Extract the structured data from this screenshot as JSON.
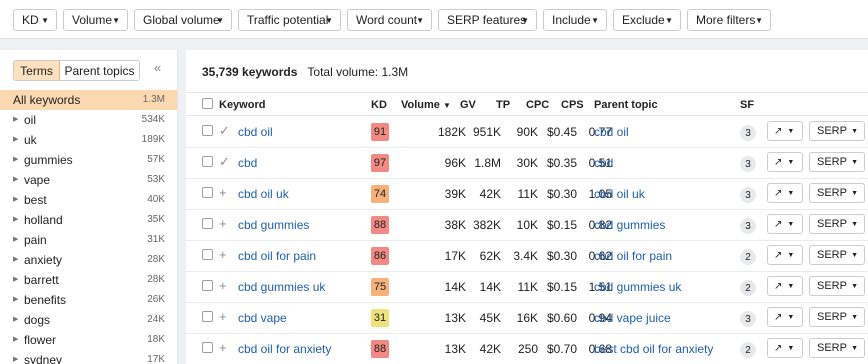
{
  "filters": [
    {
      "label": "KD"
    },
    {
      "label": "Volume"
    },
    {
      "label": "Global volume"
    },
    {
      "label": "Traffic potential"
    },
    {
      "label": "Word count"
    },
    {
      "label": "SERP features"
    },
    {
      "label": "Include"
    },
    {
      "label": "Exclude"
    },
    {
      "label": "More filters"
    }
  ],
  "sidebar": {
    "tab_terms": "Terms",
    "tab_parent": "Parent topics",
    "collapse_icon": "«",
    "all": {
      "label": "All keywords",
      "count": "1.3M"
    },
    "items": [
      {
        "label": "oil",
        "count": "534K"
      },
      {
        "label": "uk",
        "count": "189K"
      },
      {
        "label": "gummies",
        "count": "57K"
      },
      {
        "label": "vape",
        "count": "53K"
      },
      {
        "label": "best",
        "count": "40K"
      },
      {
        "label": "holland",
        "count": "35K"
      },
      {
        "label": "pain",
        "count": "31K"
      },
      {
        "label": "anxiety",
        "count": "28K"
      },
      {
        "label": "barrett",
        "count": "28K"
      },
      {
        "label": "benefits",
        "count": "26K"
      },
      {
        "label": "dogs",
        "count": "24K"
      },
      {
        "label": "flower",
        "count": "18K"
      },
      {
        "label": "sydney",
        "count": "17K"
      }
    ]
  },
  "summary": {
    "keywords": "35,739 keywords",
    "volume": "Total volume: 1.3M"
  },
  "columns": {
    "keyword": "Keyword",
    "kd": "KD",
    "volume": "Volume",
    "gv": "GV",
    "tp": "TP",
    "cpc": "CPC",
    "cps": "CPS",
    "parent": "Parent topic",
    "sf": "SF"
  },
  "rows": [
    {
      "mark": "✓",
      "keyword": "cbd oil",
      "kd": "91",
      "kd_color": "#f28a83",
      "volume": "182K",
      "gv": "951K",
      "tp": "90K",
      "cpc": "$0.45",
      "cps": "0.77",
      "parent": "cbd oil",
      "sf": "3"
    },
    {
      "mark": "✓",
      "keyword": "cbd",
      "kd": "97",
      "kd_color": "#f28a83",
      "volume": "96K",
      "gv": "1.8M",
      "tp": "30K",
      "cpc": "$0.35",
      "cps": "0.51",
      "parent": "cbd",
      "sf": "3"
    },
    {
      "mark": "+",
      "keyword": "cbd oil uk",
      "kd": "74",
      "kd_color": "#f7b27a",
      "volume": "39K",
      "gv": "42K",
      "tp": "11K",
      "cpc": "$0.30",
      "cps": "1.05",
      "parent": "cbd oil uk",
      "sf": "3"
    },
    {
      "mark": "+",
      "keyword": "cbd gummies",
      "kd": "88",
      "kd_color": "#f28a83",
      "volume": "38K",
      "gv": "382K",
      "tp": "10K",
      "cpc": "$0.15",
      "cps": "0.82",
      "parent": "cbd gummies",
      "sf": "3"
    },
    {
      "mark": "+",
      "keyword": "cbd oil for pain",
      "kd": "86",
      "kd_color": "#f28a83",
      "volume": "17K",
      "gv": "62K",
      "tp": "3.4K",
      "cpc": "$0.30",
      "cps": "0.62",
      "parent": "cbd oil for pain",
      "sf": "2"
    },
    {
      "mark": "+",
      "keyword": "cbd gummies uk",
      "kd": "75",
      "kd_color": "#f7b27a",
      "volume": "14K",
      "gv": "14K",
      "tp": "11K",
      "cpc": "$0.15",
      "cps": "1.51",
      "parent": "cbd gummies uk",
      "sf": "2"
    },
    {
      "mark": "+",
      "keyword": "cbd vape",
      "kd": "31",
      "kd_color": "#f0e27a",
      "volume": "13K",
      "gv": "45K",
      "tp": "16K",
      "cpc": "$0.60",
      "cps": "0.94",
      "parent": "cbd vape juice",
      "sf": "3"
    },
    {
      "mark": "+",
      "keyword": "cbd oil for anxiety",
      "kd": "88",
      "kd_color": "#f28a83",
      "volume": "13K",
      "gv": "42K",
      "tp": "250",
      "cpc": "$0.70",
      "cps": "0.68",
      "parent": "best cbd oil for anxiety",
      "sf": "2"
    }
  ],
  "buttons": {
    "trend_icon": "↗",
    "serp": "SERP"
  },
  "icons": {
    "caret": "▼",
    "tri": "▶",
    "sort": "▼"
  }
}
